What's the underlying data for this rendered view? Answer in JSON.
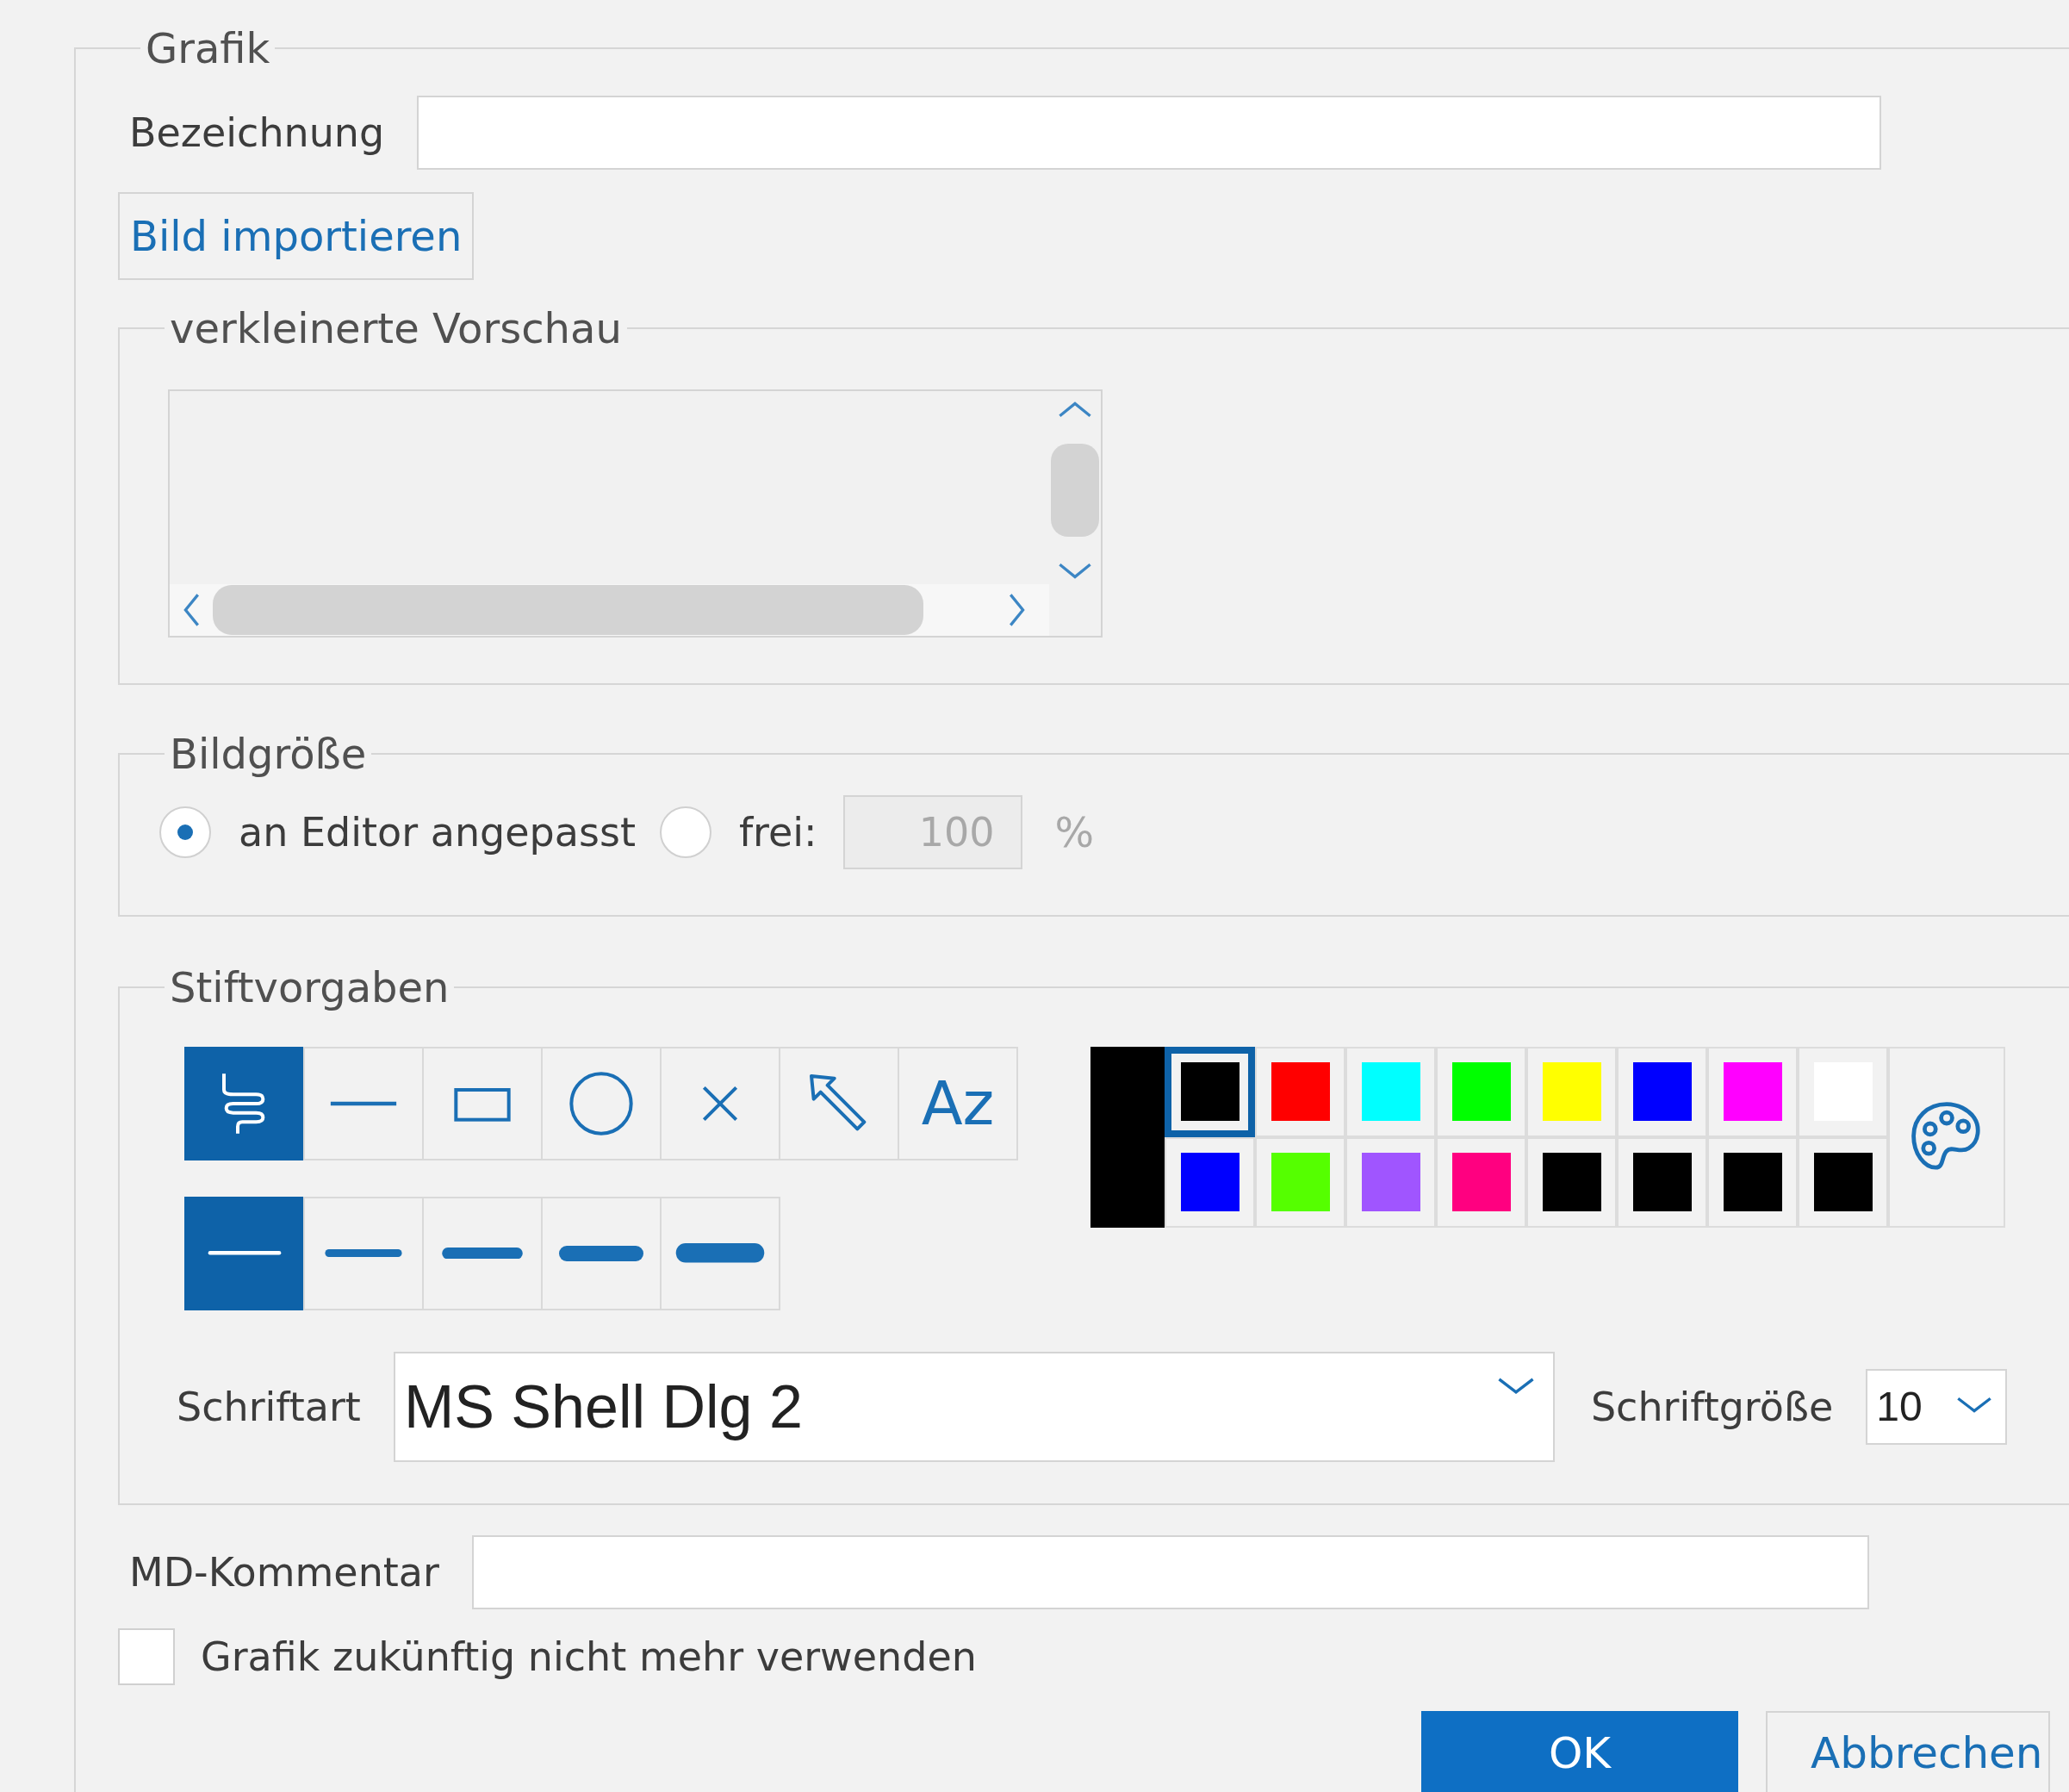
{
  "group": {
    "title": "Grafik"
  },
  "name_field": {
    "label": "Bezeichnung"
  },
  "import_button": "Bild importieren",
  "preview": {
    "title": "verkleinerte Vorschau"
  },
  "size": {
    "title": "Bildgröße",
    "options": [
      {
        "label": "an Editor angepasst",
        "selected": true
      },
      {
        "label": "frei:",
        "selected": false
      }
    ],
    "value": "100",
    "unit": "%",
    "disabled": true
  },
  "pen": {
    "title": "Stiftvorgaben",
    "tools": [
      {
        "kind": "freehand",
        "selected": true
      },
      {
        "kind": "line",
        "selected": false
      },
      {
        "kind": "rectangle",
        "selected": false
      },
      {
        "kind": "ellipse",
        "selected": false
      },
      {
        "kind": "cross",
        "selected": false
      },
      {
        "kind": "arrow",
        "selected": false
      },
      {
        "kind": "text",
        "label": "Az",
        "selected": false
      }
    ],
    "widths": [
      {
        "selected": true
      },
      {
        "selected": false
      },
      {
        "selected": false
      },
      {
        "selected": false
      },
      {
        "selected": false
      }
    ],
    "colors": [
      {
        "color": "#000000",
        "selected": true
      },
      {
        "color": "#ff0000",
        "selected": false
      },
      {
        "color": "#00ffff",
        "selected": false
      },
      {
        "color": "#00ff00",
        "selected": false
      },
      {
        "color": "#ffff00",
        "selected": false
      },
      {
        "color": "#0000ff",
        "selected": false
      },
      {
        "color": "#ff00ff",
        "selected": false
      },
      {
        "color": "#ffffff",
        "selected": false
      },
      {
        "color": "#0000ff",
        "selected": false
      },
      {
        "color": "#55ff00",
        "selected": false
      },
      {
        "color": "#a055ff",
        "selected": false
      },
      {
        "color": "#ff0080",
        "selected": false
      },
      {
        "color": "#000000",
        "selected": false
      },
      {
        "color": "#000000",
        "selected": false
      },
      {
        "color": "#000000",
        "selected": false
      },
      {
        "color": "#000000",
        "selected": false
      }
    ],
    "font": {
      "label": "Schriftart",
      "value": "MS Shell Dlg 2"
    },
    "font_size": {
      "label": "Schriftgröße",
      "value": "10"
    }
  },
  "comment": {
    "label": "MD-Kommentar"
  },
  "retire": {
    "label": "Grafik zukünftig nicht mehr verwenden",
    "checked": false
  },
  "buttons": [
    {
      "label": "OK",
      "kind": "primary"
    },
    {
      "label": "Abbrechen",
      "kind": "secondary"
    }
  ]
}
